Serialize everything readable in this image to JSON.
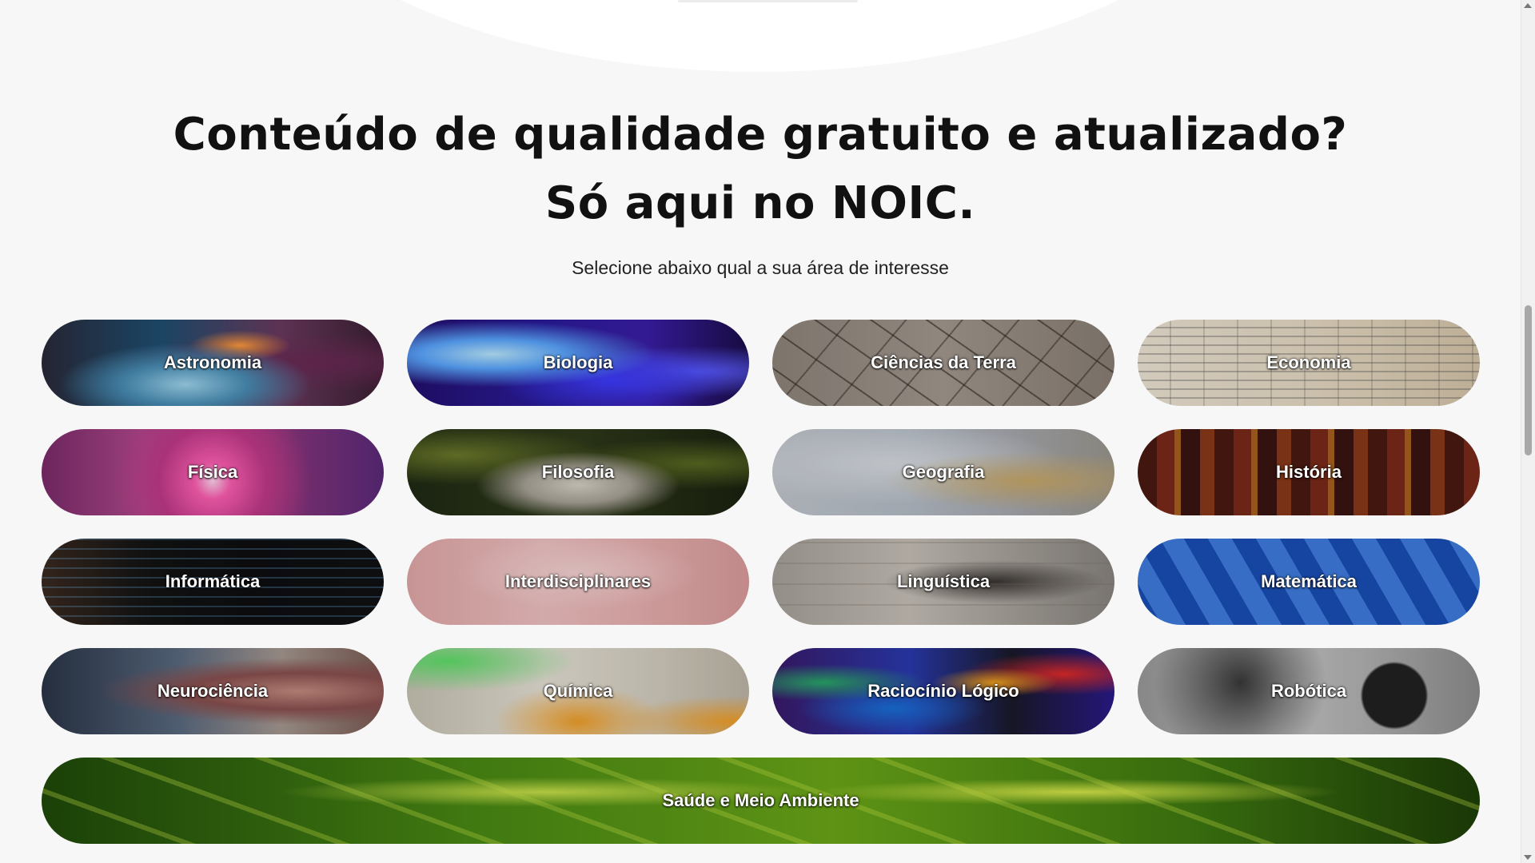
{
  "headline": {
    "line1": "Conteúdo de qualidade gratuito e atualizado?",
    "line2": "Só aqui no NOIC."
  },
  "subtitle": "Selecione abaixo qual a sua área de interesse",
  "areas": [
    {
      "label": "Astronomia"
    },
    {
      "label": "Biologia"
    },
    {
      "label": "Ciências da Terra"
    },
    {
      "label": "Economia"
    },
    {
      "label": "Física"
    },
    {
      "label": "Filosofia"
    },
    {
      "label": "Geografia"
    },
    {
      "label": "História"
    },
    {
      "label": "Informática"
    },
    {
      "label": "Interdisciplinares"
    },
    {
      "label": "Linguística"
    },
    {
      "label": "Matemática"
    },
    {
      "label": "Neurociência"
    },
    {
      "label": "Química"
    },
    {
      "label": "Raciocínio Lógico"
    },
    {
      "label": "Robótica"
    },
    {
      "label": "Saúde e Meio Ambiente"
    }
  ],
  "colors": {
    "page_background": "#f7f7f7",
    "heading": "#111111",
    "label_text": "#ffffff"
  }
}
